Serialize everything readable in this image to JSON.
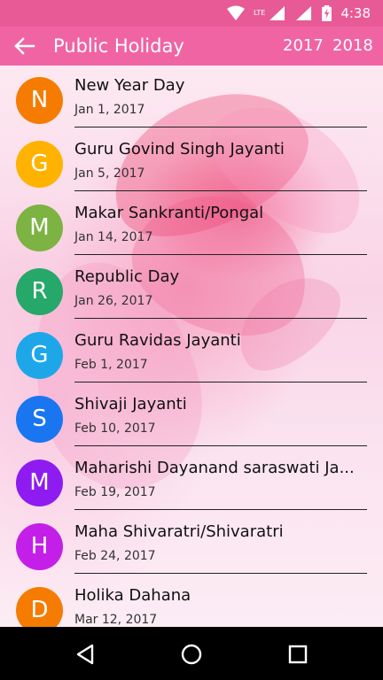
{
  "status_bar": {
    "time": "4:38",
    "network_label": "LTE"
  },
  "app_bar": {
    "title": "Public Holiday",
    "years": [
      "2017",
      "2018"
    ]
  },
  "holidays": [
    {
      "letter": "N",
      "name": "New Year Day",
      "date": "Jan 1, 2017",
      "color": "#F57C00"
    },
    {
      "letter": "G",
      "name": "Guru Govind Singh Jayanti",
      "date": "Jan 5, 2017",
      "color": "#FFB300"
    },
    {
      "letter": "M",
      "name": "Makar Sankranti/Pongal",
      "date": "Jan 14, 2017",
      "color": "#7CB342"
    },
    {
      "letter": "R",
      "name": "Republic Day",
      "date": "Jan 26, 2017",
      "color": "#26A86A"
    },
    {
      "letter": "G",
      "name": "Guru Ravidas Jayanti",
      "date": "Feb 1, 2017",
      "color": "#1EA7E8"
    },
    {
      "letter": "S",
      "name": "Shivaji Jayanti",
      "date": "Feb 10, 2017",
      "color": "#1976F0"
    },
    {
      "letter": "M",
      "name": "Maharishi Dayanand saraswati Ja...",
      "date": "Feb 19, 2017",
      "color": "#8E1CF0"
    },
    {
      "letter": "H",
      "name": "Maha Shivaratri/Shivaratri",
      "date": "Feb 24, 2017",
      "color": "#C41FE8"
    },
    {
      "letter": "D",
      "name": "Holika Dahana",
      "date": "Mar 12, 2017",
      "color": "#F57C00"
    }
  ]
}
